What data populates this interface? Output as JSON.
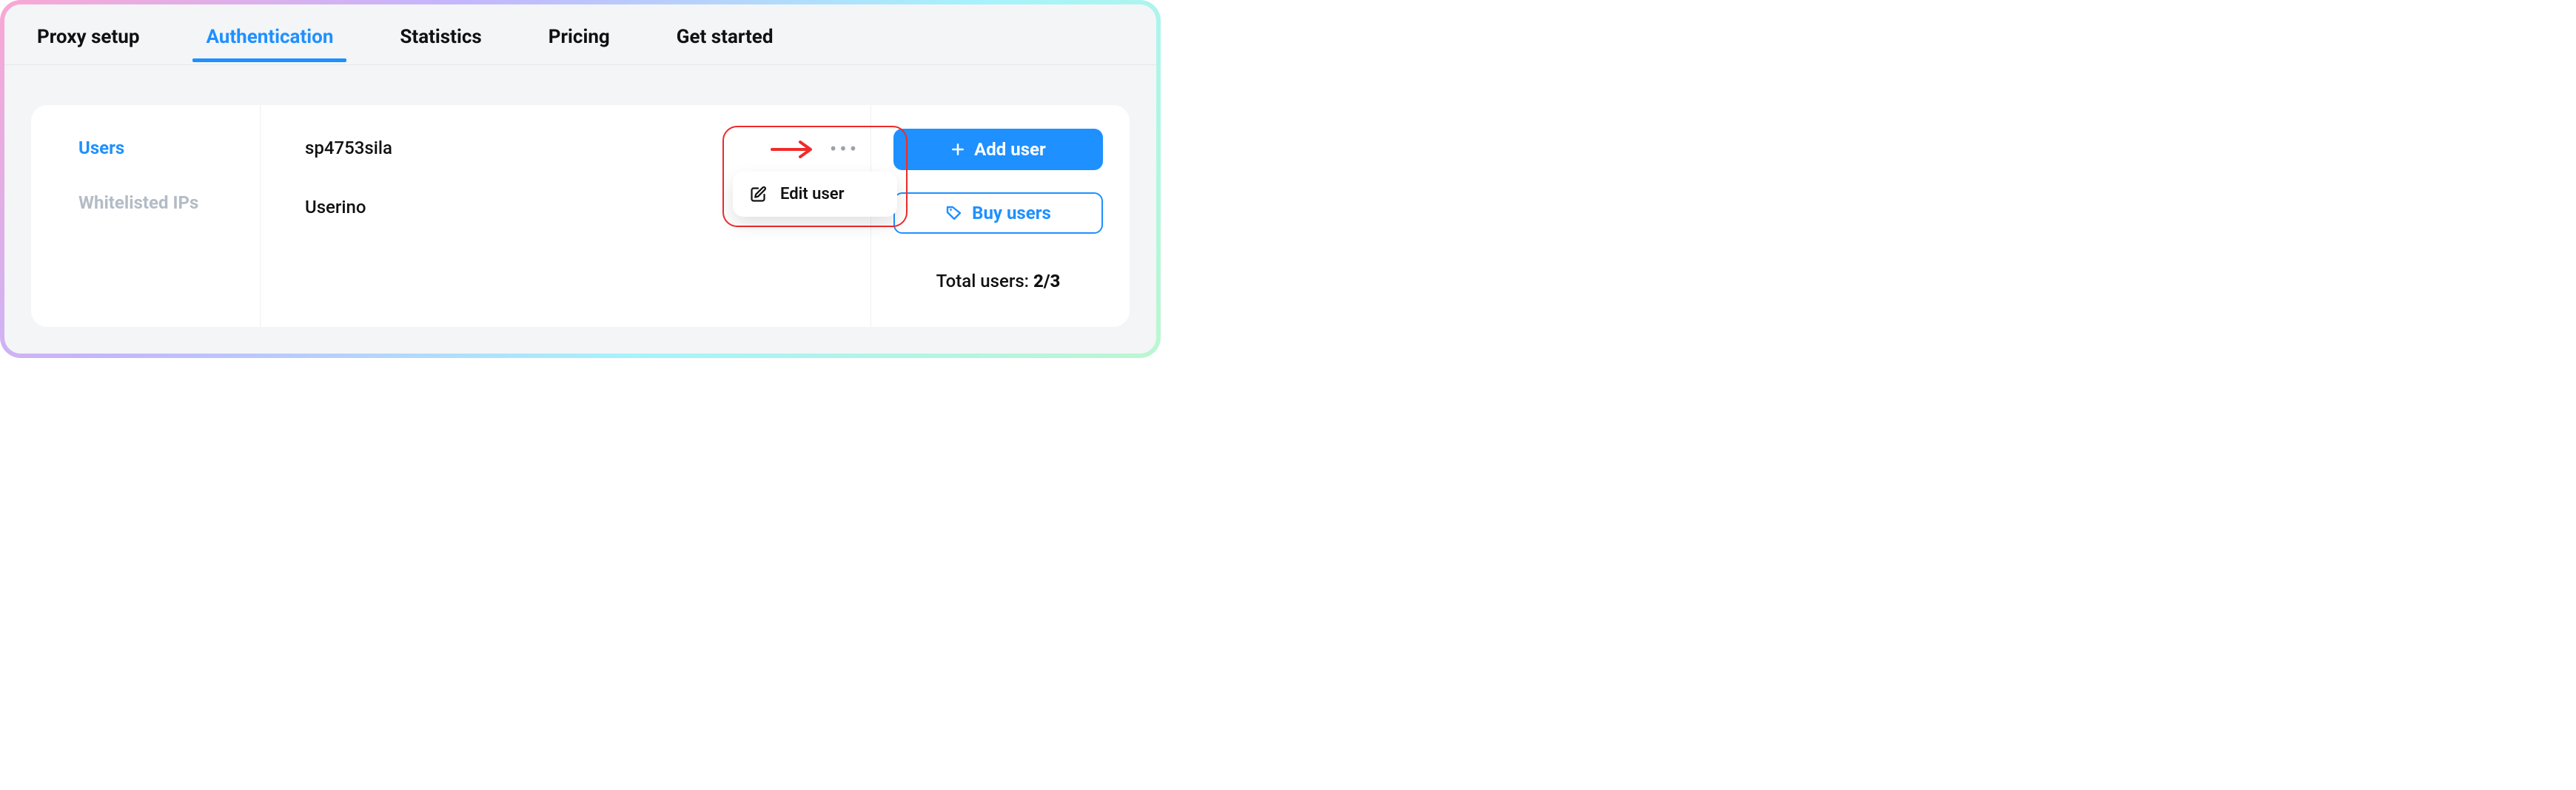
{
  "tabs": {
    "proxy_setup": "Proxy setup",
    "authentication": "Authentication",
    "statistics": "Statistics",
    "pricing": "Pricing",
    "get_started": "Get started"
  },
  "side_nav": {
    "users": "Users",
    "whitelisted_ips": "Whitelisted IPs"
  },
  "users": [
    {
      "name": "sp4753sila"
    },
    {
      "name": "Userino"
    }
  ],
  "actions": {
    "add_user": "Add user",
    "buy_users": "Buy users"
  },
  "total": {
    "label": "Total users: ",
    "value": "2/3"
  },
  "context_menu": {
    "edit_user": "Edit user"
  },
  "colors": {
    "accent": "#1e90ff",
    "callout": "#ef2b2b"
  }
}
